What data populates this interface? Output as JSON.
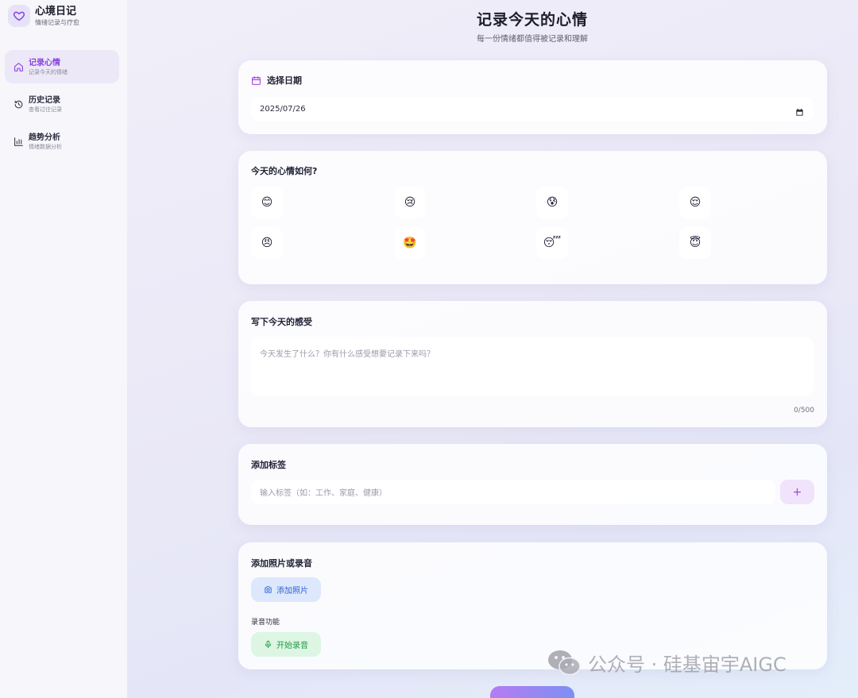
{
  "brand": {
    "title": "心境日记",
    "subtitle": "情绪记录与疗愈"
  },
  "nav": [
    {
      "label": "记录心情",
      "sub": "记录今天的情绪",
      "icon": "home-icon",
      "active": true
    },
    {
      "label": "历史记录",
      "sub": "查看过往记录",
      "icon": "history-icon",
      "active": false
    },
    {
      "label": "趋势分析",
      "sub": "情绪数据分析",
      "icon": "bar-chart-icon",
      "active": false
    }
  ],
  "header": {
    "title": "记录今天的心情",
    "subtitle": "每一份情绪都值得被记录和理解"
  },
  "date_card": {
    "title": "选择日期",
    "value": "2025/07/26"
  },
  "mood_card": {
    "title": "今天的心情如何?",
    "moods": [
      "😊",
      "😢",
      "😰",
      "😌",
      "😠",
      "🤩",
      "😴",
      "😇"
    ]
  },
  "text_card": {
    "title": "写下今天的感受",
    "placeholder": "今天发生了什么？你有什么感受想要记录下来吗？",
    "counter": "0/500"
  },
  "tag_card": {
    "title": "添加标签",
    "placeholder": "输入标签（如：工作、家庭、健康）",
    "add_label": "+"
  },
  "media_card": {
    "title": "添加照片或录音",
    "photo_label": "添加照片",
    "record_section_label": "录音功能",
    "record_label": "开始录音"
  },
  "watermark": "公众号 · 硅基宙宇AIGC",
  "colors": {
    "accent": "#8a3fe0",
    "photo": "#2e5fd0",
    "record": "#1f9a44"
  }
}
